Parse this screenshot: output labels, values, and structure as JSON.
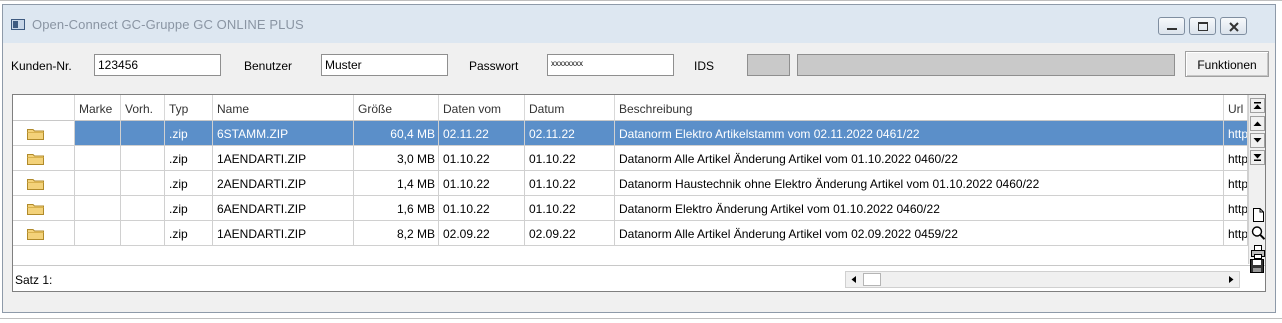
{
  "window": {
    "title": "Open-Connect GC-Gruppe GC ONLINE PLUS"
  },
  "toolbar": {
    "customer_label": "Kunden-Nr.",
    "customer_value": "123456",
    "user_label": "Benutzer",
    "user_value": "Muster",
    "password_label": "Passwort",
    "password_value": "xxxxxxxx",
    "ids_label": "IDS",
    "ids_value": "",
    "ids_extra_value": "",
    "functions_button": "Funktionen"
  },
  "grid": {
    "columns": [
      "Marke",
      "Vorh.",
      "Typ",
      "Name",
      "Größe",
      "Daten vom",
      "Datum",
      "Beschreibung",
      "Url"
    ],
    "rows": [
      {
        "marke": "",
        "vorh": "",
        "typ": ".zip",
        "name": "6STAMM.ZIP",
        "groesse": "60,4 MB",
        "daten_vom": "02.11.22",
        "datum": "02.11.22",
        "beschreibung": "Datanorm Elektro Artikelstamm vom 02.11.2022 0461/22",
        "url": "http",
        "selected": true
      },
      {
        "marke": "",
        "vorh": "",
        "typ": ".zip",
        "name": "1AENDARTI.ZIP",
        "groesse": "3,0 MB",
        "daten_vom": "01.10.22",
        "datum": "01.10.22",
        "beschreibung": "Datanorm Alle Artikel Änderung Artikel vom 01.10.2022 0460/22",
        "url": "http",
        "selected": false
      },
      {
        "marke": "",
        "vorh": "",
        "typ": ".zip",
        "name": "2AENDARTI.ZIP",
        "groesse": "1,4 MB",
        "daten_vom": "01.10.22",
        "datum": "01.10.22",
        "beschreibung": "Datanorm Haustechnik ohne Elektro Änderung Artikel vom 01.10.2022 0460/22",
        "url": "http",
        "selected": false
      },
      {
        "marke": "",
        "vorh": "",
        "typ": ".zip",
        "name": "6AENDARTI.ZIP",
        "groesse": "1,6 MB",
        "daten_vom": "01.10.22",
        "datum": "01.10.22",
        "beschreibung": "Datanorm Elektro Änderung Artikel vom 01.10.2022 0460/22",
        "url": "http",
        "selected": false
      },
      {
        "marke": "",
        "vorh": "",
        "typ": ".zip",
        "name": "1AENDARTI.ZIP",
        "groesse": "8,2 MB",
        "daten_vom": "02.09.22",
        "datum": "02.09.22",
        "beschreibung": "Datanorm Alle Artikel Änderung Artikel vom 02.09.2022 0459/22",
        "url": "http",
        "selected": false
      }
    ]
  },
  "status": {
    "record_label": "Satz 1:"
  },
  "colors": {
    "selection": "#5b8fc9",
    "titlebar": "#dde7f1",
    "window_bg": "#f0f0f0"
  },
  "icons": [
    "folder-icon",
    "minimize-icon",
    "maximize-icon",
    "close-icon",
    "scroll-top-icon",
    "scroll-up-icon",
    "scroll-down-icon",
    "scroll-bottom-icon",
    "new-document-icon",
    "search-icon",
    "print-icon",
    "save-icon"
  ]
}
